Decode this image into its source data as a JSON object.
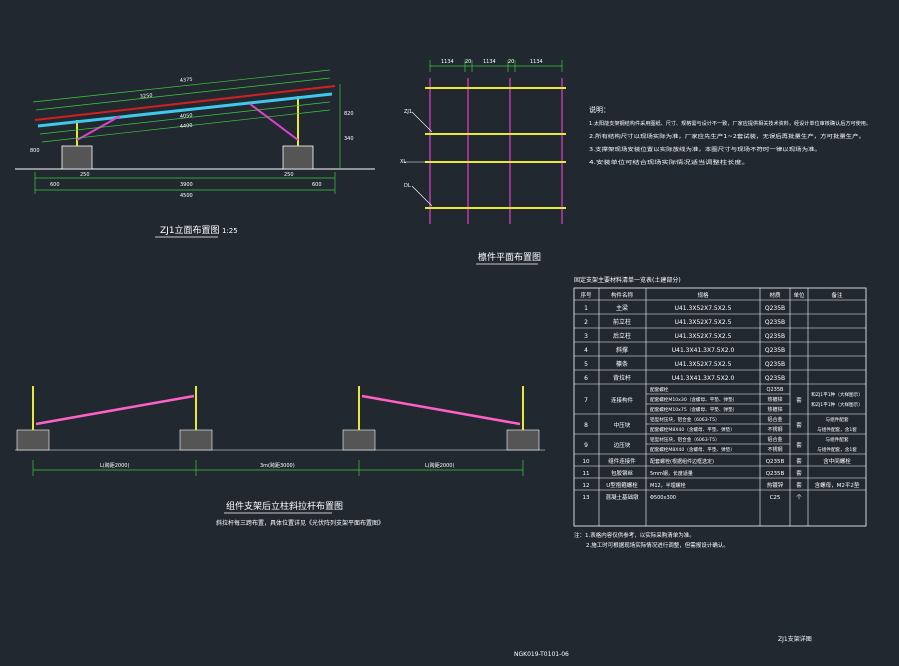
{
  "colors": {
    "background": "#212830",
    "white": "#ffffff",
    "green": "#3ecb3e",
    "yellow": "#e8e838",
    "magenta": "#e040d0",
    "pink": "#ff60c8",
    "cyan": "#40c8e8",
    "red": "#d02020"
  },
  "front_view": {
    "title": "ZJ1立面布置图",
    "scale": "1:25",
    "dims_top": [
      "4375",
      "3250",
      "4050",
      "4400"
    ],
    "dims_bottom": [
      "600",
      "250",
      "3900",
      "250",
      "600"
    ],
    "total_width": "4500",
    "side_dims": [
      "800",
      "820",
      "340"
    ]
  },
  "plan_view": {
    "title": "檩件平面布置图",
    "dims_top": [
      "1134",
      "20",
      "1134",
      "20",
      "1134"
    ],
    "labels": [
      "ZJ1",
      "XL",
      "DL"
    ]
  },
  "notes": {
    "title": "说明：",
    "items": [
      "1.太阳能支架钢结构件采用图纸、尺寸、规格需与设计不一致，厂家应提供相关技术资料，经设计单位审核确认后方可使用。",
      "2.所有结构尺寸以现场实际为准，厂家应先生产1~2套试装，无误后再批量生产，方可批量生产。",
      "3.支撑架现场安装位置以实际放线为准，本图尺寸与现场不符时一律以现场为准。",
      "4.安装单位可结合现场实际情况适当调整柱长度。"
    ]
  },
  "table": {
    "title": "固定支架主要材料清单一览表(土建部分)",
    "headers": [
      "序号",
      "构件名称",
      "规格",
      "材质",
      "单位",
      "备注"
    ],
    "rows": [
      [
        "1",
        "主梁",
        "U41.3X52X7.5X2.5",
        "Q235B",
        "",
        ""
      ],
      [
        "2",
        "前立柱",
        "U41.3X52X7.5X2.5",
        "Q235B",
        "",
        ""
      ],
      [
        "3",
        "后立柱",
        "U41.3X52X7.5X2.5",
        "Q235B",
        "",
        ""
      ],
      [
        "4",
        "斜撑",
        "U41.3X41.3X7.5X2.0",
        "Q235B",
        "",
        ""
      ],
      [
        "5",
        "檩条",
        "U41.3X52X7.5X2.5",
        "Q235B",
        "",
        ""
      ],
      [
        "6",
        "背拉杆",
        "U41.3X41.3X7.5X2.0",
        "Q235B",
        "",
        ""
      ]
    ],
    "row7": {
      "no": "7",
      "name": "连接构件",
      "sub": [
        "配套螺栓",
        "配套螺栓M10x30（含螺母、平垫、弹垫）",
        "配套螺栓M10x75（含螺母、平垫、弹垫）"
      ],
      "material": [
        "Q235B",
        "热镀锌",
        "热镀锌"
      ],
      "unit": "套",
      "remark": [
        "和ZJ1平1种（大样图示）",
        "和ZJ1平1种（大样图示）"
      ]
    },
    "row8": {
      "no": "8",
      "name": "中压块",
      "sub": [
        "铝型材压块，铝合金（6063-T5）",
        "配套螺栓M8X40（含螺母、平垫、弹垫）"
      ],
      "material": [
        "铝合金",
        "不锈钢"
      ],
      "unit": "套",
      "remark": [
        "与组件配套",
        "与组件配套，含1套"
      ]
    },
    "row9": {
      "no": "9",
      "name": "边压块",
      "sub": [
        "铝型材压块，铝合金（6063-T5）",
        "配套螺栓M8X40（含螺母、平垫、弹垫）"
      ],
      "material": [
        "铝合金",
        "不锈钢"
      ],
      "unit": "套",
      "remark": [
        "与组件配套",
        "与组件配套，含1套"
      ]
    },
    "tail_rows": [
      [
        "10",
        "组件连接件",
        "配套螺栓(根据组件边框选定)",
        "Q235B",
        "套",
        "含中间螺栓"
      ],
      [
        "11",
        "包胶钢丝",
        "5mm钢，长度适量",
        "Q235B",
        "套",
        ""
      ],
      [
        "12",
        "U型抱箍螺栓",
        "M12，半埋螺栓",
        "热镀锌",
        "套",
        "含螺母，M2平2垫"
      ],
      [
        "13",
        "混凝土基础墩",
        "Φ500x300",
        "C25",
        "个",
        ""
      ]
    ],
    "footnotes": [
      "注：1.表格内容仅供参考，以实际采购清单为准。",
      "2.施工时可根据现场实际情况进行调整，但需报设计确认。"
    ]
  },
  "elevation": {
    "title": "组件支架后立柱斜拉杆布置图",
    "subtitle": "斜拉杆每三跨布置，具体位置详见《光伏阵列支架平面布置图》",
    "dims": [
      "L(跨距2000)",
      "3m(跨距3000)",
      "L(跨距2000)"
    ]
  },
  "title_block": {
    "drawing_name": "ZJ1支架详图",
    "drawing_no": "NGK019-T0101-06"
  }
}
